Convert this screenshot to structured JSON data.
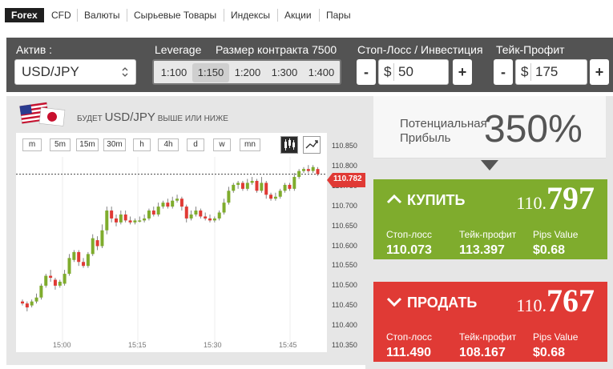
{
  "tabs": [
    "Forex",
    "CFD",
    "Валюты",
    "Сырьевые Товары",
    "Индексы",
    "Акции",
    "Пары"
  ],
  "controls": {
    "asset_label": "Актив :",
    "asset_value": "USD/JPY",
    "leverage_label": "Leverage",
    "leverage_options": [
      "1:100",
      "1:150",
      "1:200",
      "1:300",
      "1:400"
    ],
    "leverage_selected": "1:150",
    "contract_label": "Размер контракта 7500",
    "stoploss_label": "Стоп-Лосс / Инвестиция",
    "stoploss_value": "50",
    "takeprofit_label": "Тейк-Профит",
    "takeprofit_value": "175",
    "currency_symbol": "$",
    "minus": "-",
    "plus": "+"
  },
  "chart_header": {
    "prefix": "будет",
    "pair": "USD/JPY",
    "suffix": "выше или ниже"
  },
  "timeframes": [
    "m",
    "5m",
    "15m",
    "30m",
    "h",
    "4h",
    "d",
    "w",
    "mn"
  ],
  "current_price_tag": "110.782",
  "colors": {
    "up": "#7fac2d",
    "down": "#e03a35",
    "panel": "#535353",
    "tag": "#e03a35"
  },
  "chart_data": {
    "type": "candlestick",
    "yticks": [
      "110.850",
      "110.800",
      "110.750",
      "110.700",
      "110.650",
      "110.600",
      "110.550",
      "110.500",
      "110.450",
      "110.400",
      "110.350"
    ],
    "xticks": [
      "15:00",
      "15:15",
      "15:30",
      "15:45"
    ],
    "ylim": [
      110.35,
      110.85
    ],
    "current": 110.782,
    "candles": [
      [
        110.46,
        110.455,
        110.465,
        110.45
      ],
      [
        110.455,
        110.445,
        110.46,
        110.435
      ],
      [
        110.45,
        110.46,
        110.465,
        110.445
      ],
      [
        110.46,
        110.47,
        110.48,
        110.455
      ],
      [
        110.47,
        110.5,
        110.505,
        110.465
      ],
      [
        110.5,
        110.525,
        110.53,
        110.495
      ],
      [
        110.525,
        110.52,
        110.54,
        110.51
      ],
      [
        110.515,
        110.5,
        110.52,
        110.49
      ],
      [
        110.5,
        110.51,
        110.515,
        110.495
      ],
      [
        110.505,
        110.53,
        110.54,
        110.5
      ],
      [
        110.53,
        110.57,
        110.58,
        110.525
      ],
      [
        110.565,
        110.585,
        110.59,
        110.56
      ],
      [
        110.585,
        110.56,
        110.59,
        110.55
      ],
      [
        110.56,
        110.55,
        110.57,
        110.545
      ],
      [
        110.55,
        110.58,
        110.585,
        110.545
      ],
      [
        110.58,
        110.62,
        110.63,
        110.575
      ],
      [
        110.615,
        110.6,
        110.625,
        110.59
      ],
      [
        110.6,
        110.64,
        110.655,
        110.595
      ],
      [
        110.64,
        110.69,
        110.7,
        110.63
      ],
      [
        110.69,
        110.67,
        110.7,
        110.66
      ],
      [
        110.67,
        110.66,
        110.68,
        110.65
      ],
      [
        110.66,
        110.68,
        110.69,
        110.655
      ],
      [
        110.68,
        110.665,
        110.69,
        110.66
      ],
      [
        110.665,
        110.66,
        110.675,
        110.655
      ],
      [
        110.66,
        110.665,
        110.67,
        110.655
      ],
      [
        110.665,
        110.665,
        110.675,
        110.66
      ],
      [
        110.665,
        110.67,
        110.68,
        110.66
      ],
      [
        110.67,
        110.69,
        110.695,
        110.665
      ],
      [
        110.69,
        110.68,
        110.7,
        110.675
      ],
      [
        110.68,
        110.7,
        110.71,
        110.675
      ],
      [
        110.7,
        110.71,
        110.715,
        110.695
      ],
      [
        110.71,
        110.7,
        110.72,
        110.695
      ],
      [
        110.7,
        110.715,
        110.725,
        110.695
      ],
      [
        110.715,
        110.72,
        110.73,
        110.71
      ],
      [
        110.72,
        110.7,
        110.725,
        110.69
      ],
      [
        110.7,
        110.67,
        110.705,
        110.66
      ],
      [
        110.67,
        110.68,
        110.69,
        110.665
      ],
      [
        110.68,
        110.69,
        110.7,
        110.675
      ],
      [
        110.69,
        110.675,
        110.695,
        110.67
      ],
      [
        110.675,
        110.67,
        110.685,
        110.665
      ],
      [
        110.67,
        110.665,
        110.68,
        110.66
      ],
      [
        110.665,
        110.67,
        110.675,
        110.66
      ],
      [
        110.67,
        110.685,
        110.69,
        110.665
      ],
      [
        110.685,
        110.71,
        110.72,
        110.68
      ],
      [
        110.71,
        110.74,
        110.75,
        110.705
      ],
      [
        110.74,
        110.755,
        110.76,
        110.735
      ],
      [
        110.755,
        110.76,
        110.765,
        110.745
      ],
      [
        110.76,
        110.745,
        110.765,
        110.74
      ],
      [
        110.745,
        110.76,
        110.77,
        110.74
      ],
      [
        110.76,
        110.765,
        110.775,
        110.755
      ],
      [
        110.765,
        110.74,
        110.77,
        110.735
      ],
      [
        110.74,
        110.76,
        110.775,
        110.735
      ],
      [
        110.76,
        110.73,
        110.765,
        110.72
      ],
      [
        110.73,
        110.72,
        110.735,
        110.715
      ],
      [
        110.72,
        110.725,
        110.735,
        110.715
      ],
      [
        110.725,
        110.74,
        110.745,
        110.72
      ],
      [
        110.74,
        110.755,
        110.76,
        110.735
      ],
      [
        110.755,
        110.745,
        110.76,
        110.74
      ],
      [
        110.745,
        110.775,
        110.785,
        110.74
      ],
      [
        110.775,
        110.79,
        110.795,
        110.77
      ],
      [
        110.79,
        110.795,
        110.8,
        110.785
      ],
      [
        110.795,
        110.79,
        110.805,
        110.785
      ],
      [
        110.79,
        110.8,
        110.805,
        110.785
      ],
      [
        110.795,
        110.782,
        110.8,
        110.778
      ]
    ]
  },
  "profit": {
    "label_line1": "Потенциальная",
    "label_line2": "Прибыль",
    "value": "350%"
  },
  "buy": {
    "label": "КУПИТЬ",
    "price_small": "110.",
    "price_big": "797",
    "stoploss_label": "Стоп-лосс",
    "stoploss": "110.073",
    "takeprofit_label": "Тейк-профит",
    "takeprofit": "113.397",
    "pips_label": "Pips Value",
    "pips": "$0.68"
  },
  "sell": {
    "label": "ПРОДАТЬ",
    "price_small": "110.",
    "price_big": "767",
    "stoploss_label": "Стоп-лосс",
    "stoploss": "111.490",
    "takeprofit_label": "Тейк-профит",
    "takeprofit": "108.167",
    "pips_label": "Pips Value",
    "pips": "$0.68"
  }
}
